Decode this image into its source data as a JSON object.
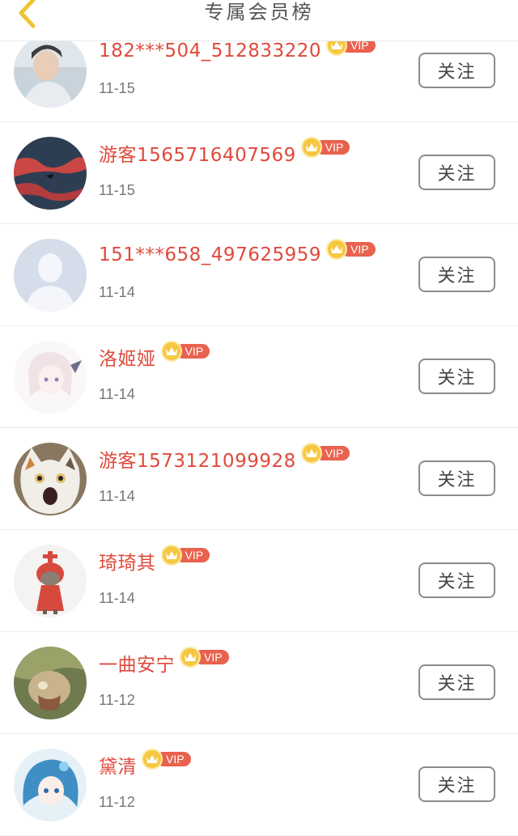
{
  "header": {
    "title": "专属会员榜",
    "back_icon": "chevron-left-icon"
  },
  "members": [
    {
      "name": "182***504_512833220",
      "vip_label": "VIP",
      "date": "11-15",
      "follow_label": "关注",
      "avatar": "photo-young-man"
    },
    {
      "name": "游客1565716407569",
      "vip_label": "VIP",
      "date": "11-15",
      "follow_label": "关注",
      "avatar": "red-sky-landscape"
    },
    {
      "name": "151***658_497625959",
      "vip_label": "VIP",
      "date": "11-14",
      "follow_label": "关注",
      "avatar": "default-silhouette"
    },
    {
      "name": "洛姬娅",
      "vip_label": "VIP",
      "date": "11-14",
      "follow_label": "关注",
      "avatar": "anime-girl"
    },
    {
      "name": "游客1573121099928",
      "vip_label": "VIP",
      "date": "11-14",
      "follow_label": "关注",
      "avatar": "screaming-cat"
    },
    {
      "name": "琦琦其",
      "vip_label": "VIP",
      "date": "11-14",
      "follow_label": "关注",
      "avatar": "cartoon-red-dress"
    },
    {
      "name": "一曲安宁",
      "vip_label": "VIP",
      "date": "11-12",
      "follow_label": "关注",
      "avatar": "cat-photo"
    },
    {
      "name": "黛清",
      "vip_label": "VIP",
      "date": "11-12",
      "follow_label": "关注",
      "avatar": "anime-blue-hair"
    }
  ],
  "colors": {
    "name": "#e0493b",
    "vip_tag": "#e9624e",
    "crown": "#f6c842",
    "back_icon": "#f0c436"
  }
}
